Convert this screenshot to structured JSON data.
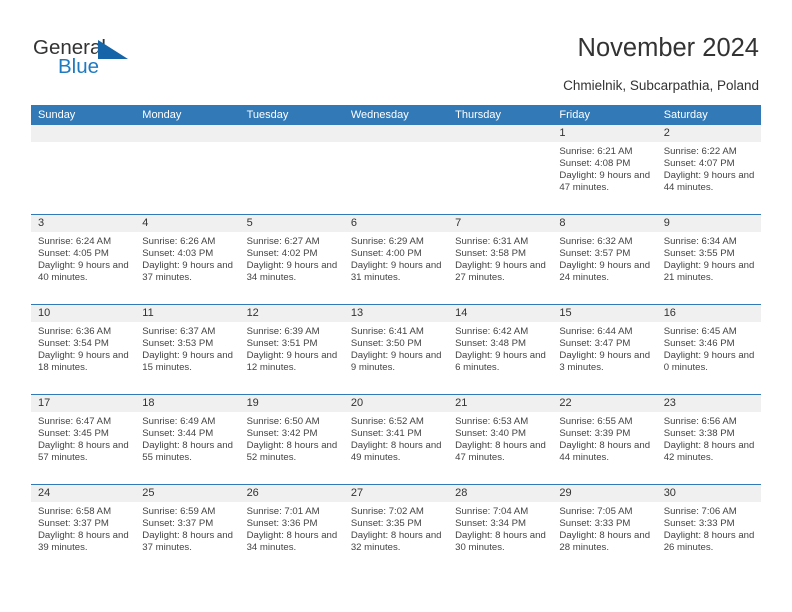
{
  "brand": {
    "name_part1": "General",
    "name_part2": "Blue",
    "triangle_color": "#1565a8",
    "blue_color": "#1f7bc1"
  },
  "header": {
    "title": "November 2024",
    "subtitle": "Chmielnik, Subcarpathia, Poland"
  },
  "theme": {
    "header_blue": "#3279b7",
    "band_gray": "#f0f0f0",
    "text_dark": "#333333",
    "text_body": "#444444"
  },
  "weekdays": [
    "Sunday",
    "Monday",
    "Tuesday",
    "Wednesday",
    "Thursday",
    "Friday",
    "Saturday"
  ],
  "labels": {
    "sunrise": "Sunrise:",
    "sunset": "Sunset:",
    "daylight": "Daylight:"
  },
  "weeks": [
    [
      {
        "day": "",
        "empty": true
      },
      {
        "day": "",
        "empty": true
      },
      {
        "day": "",
        "empty": true
      },
      {
        "day": "",
        "empty": true
      },
      {
        "day": "",
        "empty": true
      },
      {
        "day": "1",
        "sunrise": "Sunrise: 6:21 AM",
        "sunset": "Sunset: 4:08 PM",
        "daylight": "Daylight: 9 hours and 47 minutes."
      },
      {
        "day": "2",
        "sunrise": "Sunrise: 6:22 AM",
        "sunset": "Sunset: 4:07 PM",
        "daylight": "Daylight: 9 hours and 44 minutes."
      }
    ],
    [
      {
        "day": "3",
        "sunrise": "Sunrise: 6:24 AM",
        "sunset": "Sunset: 4:05 PM",
        "daylight": "Daylight: 9 hours and 40 minutes."
      },
      {
        "day": "4",
        "sunrise": "Sunrise: 6:26 AM",
        "sunset": "Sunset: 4:03 PM",
        "daylight": "Daylight: 9 hours and 37 minutes."
      },
      {
        "day": "5",
        "sunrise": "Sunrise: 6:27 AM",
        "sunset": "Sunset: 4:02 PM",
        "daylight": "Daylight: 9 hours and 34 minutes."
      },
      {
        "day": "6",
        "sunrise": "Sunrise: 6:29 AM",
        "sunset": "Sunset: 4:00 PM",
        "daylight": "Daylight: 9 hours and 31 minutes."
      },
      {
        "day": "7",
        "sunrise": "Sunrise: 6:31 AM",
        "sunset": "Sunset: 3:58 PM",
        "daylight": "Daylight: 9 hours and 27 minutes."
      },
      {
        "day": "8",
        "sunrise": "Sunrise: 6:32 AM",
        "sunset": "Sunset: 3:57 PM",
        "daylight": "Daylight: 9 hours and 24 minutes."
      },
      {
        "day": "9",
        "sunrise": "Sunrise: 6:34 AM",
        "sunset": "Sunset: 3:55 PM",
        "daylight": "Daylight: 9 hours and 21 minutes."
      }
    ],
    [
      {
        "day": "10",
        "sunrise": "Sunrise: 6:36 AM",
        "sunset": "Sunset: 3:54 PM",
        "daylight": "Daylight: 9 hours and 18 minutes."
      },
      {
        "day": "11",
        "sunrise": "Sunrise: 6:37 AM",
        "sunset": "Sunset: 3:53 PM",
        "daylight": "Daylight: 9 hours and 15 minutes."
      },
      {
        "day": "12",
        "sunrise": "Sunrise: 6:39 AM",
        "sunset": "Sunset: 3:51 PM",
        "daylight": "Daylight: 9 hours and 12 minutes."
      },
      {
        "day": "13",
        "sunrise": "Sunrise: 6:41 AM",
        "sunset": "Sunset: 3:50 PM",
        "daylight": "Daylight: 9 hours and 9 minutes."
      },
      {
        "day": "14",
        "sunrise": "Sunrise: 6:42 AM",
        "sunset": "Sunset: 3:48 PM",
        "daylight": "Daylight: 9 hours and 6 minutes."
      },
      {
        "day": "15",
        "sunrise": "Sunrise: 6:44 AM",
        "sunset": "Sunset: 3:47 PM",
        "daylight": "Daylight: 9 hours and 3 minutes."
      },
      {
        "day": "16",
        "sunrise": "Sunrise: 6:45 AM",
        "sunset": "Sunset: 3:46 PM",
        "daylight": "Daylight: 9 hours and 0 minutes."
      }
    ],
    [
      {
        "day": "17",
        "sunrise": "Sunrise: 6:47 AM",
        "sunset": "Sunset: 3:45 PM",
        "daylight": "Daylight: 8 hours and 57 minutes."
      },
      {
        "day": "18",
        "sunrise": "Sunrise: 6:49 AM",
        "sunset": "Sunset: 3:44 PM",
        "daylight": "Daylight: 8 hours and 55 minutes."
      },
      {
        "day": "19",
        "sunrise": "Sunrise: 6:50 AM",
        "sunset": "Sunset: 3:42 PM",
        "daylight": "Daylight: 8 hours and 52 minutes."
      },
      {
        "day": "20",
        "sunrise": "Sunrise: 6:52 AM",
        "sunset": "Sunset: 3:41 PM",
        "daylight": "Daylight: 8 hours and 49 minutes."
      },
      {
        "day": "21",
        "sunrise": "Sunrise: 6:53 AM",
        "sunset": "Sunset: 3:40 PM",
        "daylight": "Daylight: 8 hours and 47 minutes."
      },
      {
        "day": "22",
        "sunrise": "Sunrise: 6:55 AM",
        "sunset": "Sunset: 3:39 PM",
        "daylight": "Daylight: 8 hours and 44 minutes."
      },
      {
        "day": "23",
        "sunrise": "Sunrise: 6:56 AM",
        "sunset": "Sunset: 3:38 PM",
        "daylight": "Daylight: 8 hours and 42 minutes."
      }
    ],
    [
      {
        "day": "24",
        "sunrise": "Sunrise: 6:58 AM",
        "sunset": "Sunset: 3:37 PM",
        "daylight": "Daylight: 8 hours and 39 minutes."
      },
      {
        "day": "25",
        "sunrise": "Sunrise: 6:59 AM",
        "sunset": "Sunset: 3:37 PM",
        "daylight": "Daylight: 8 hours and 37 minutes."
      },
      {
        "day": "26",
        "sunrise": "Sunrise: 7:01 AM",
        "sunset": "Sunset: 3:36 PM",
        "daylight": "Daylight: 8 hours and 34 minutes."
      },
      {
        "day": "27",
        "sunrise": "Sunrise: 7:02 AM",
        "sunset": "Sunset: 3:35 PM",
        "daylight": "Daylight: 8 hours and 32 minutes."
      },
      {
        "day": "28",
        "sunrise": "Sunrise: 7:04 AM",
        "sunset": "Sunset: 3:34 PM",
        "daylight": "Daylight: 8 hours and 30 minutes."
      },
      {
        "day": "29",
        "sunrise": "Sunrise: 7:05 AM",
        "sunset": "Sunset: 3:33 PM",
        "daylight": "Daylight: 8 hours and 28 minutes."
      },
      {
        "day": "30",
        "sunrise": "Sunrise: 7:06 AM",
        "sunset": "Sunset: 3:33 PM",
        "daylight": "Daylight: 8 hours and 26 minutes."
      }
    ]
  ]
}
